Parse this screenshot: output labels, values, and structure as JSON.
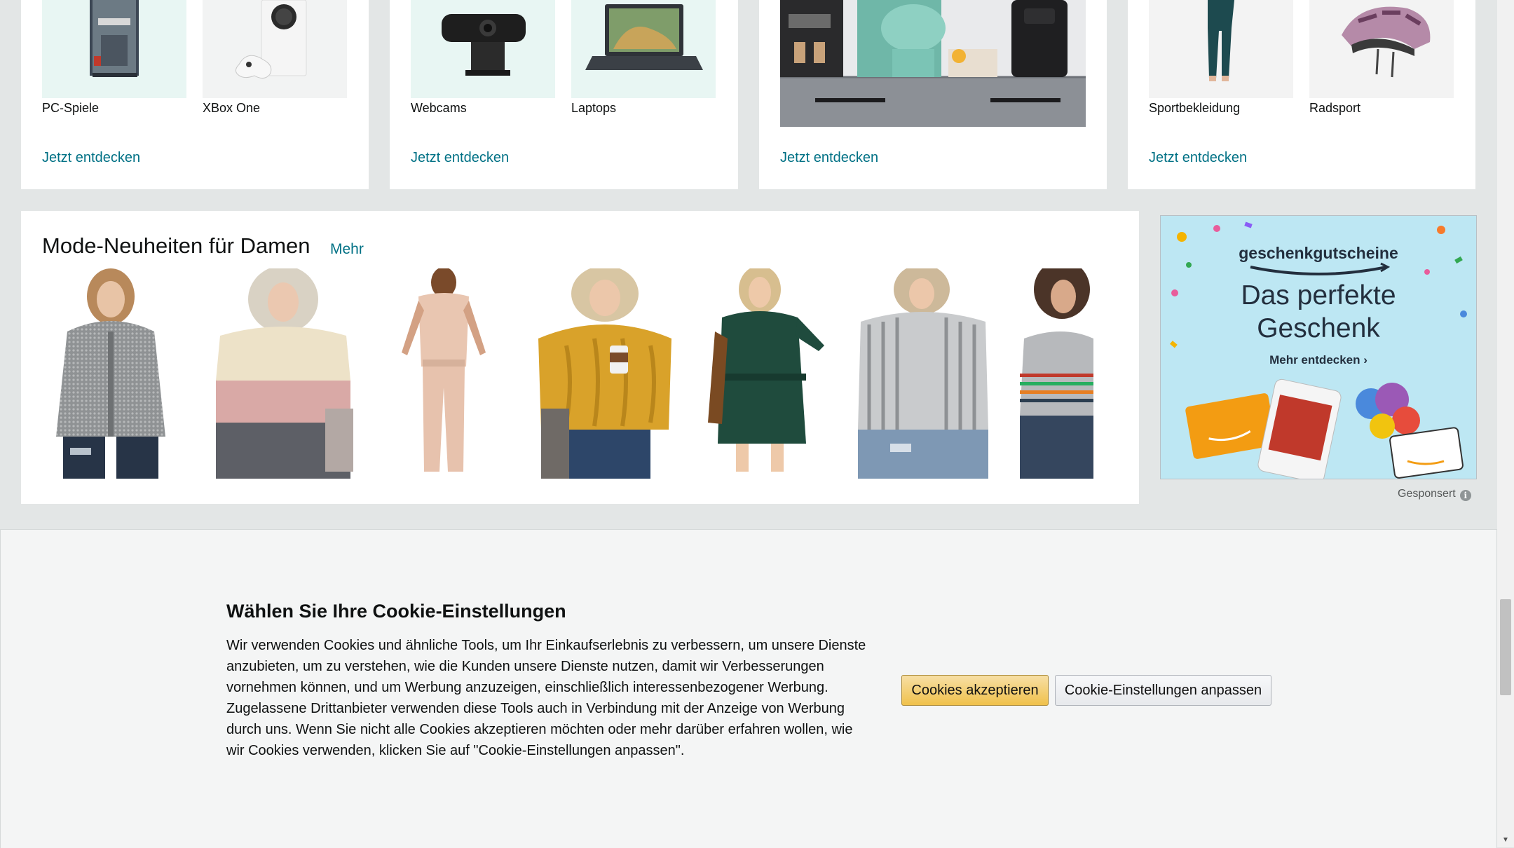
{
  "category_cards": [
    {
      "tiles": [
        {
          "label": "PC-Spiele",
          "image": "pc-game-box"
        },
        {
          "label": "XBox One",
          "image": "xbox-console"
        }
      ],
      "link": "Jetzt entdecken"
    },
    {
      "tiles": [
        {
          "label": "Webcams",
          "image": "webcam"
        },
        {
          "label": "Laptops",
          "image": "laptop"
        }
      ],
      "link": "Jetzt entdecken"
    },
    {
      "image": "kitchen-appliances",
      "link": "Jetzt entdecken"
    },
    {
      "tiles": [
        {
          "label": "Sportbekleidung",
          "image": "leggings"
        },
        {
          "label": "Radsport",
          "image": "bike-helmet"
        }
      ],
      "link": "Jetzt entdecken"
    }
  ],
  "fashion": {
    "title": "Mode-Neuheiten für Damen",
    "more_link": "Mehr",
    "items": [
      {
        "image": "grey-knit-jacket"
      },
      {
        "image": "pink-colorblock-sweater"
      },
      {
        "image": "beige-jumpsuit"
      },
      {
        "image": "mustard-cable-sweater"
      },
      {
        "image": "green-knit-dress"
      },
      {
        "image": "striped-shirt"
      },
      {
        "image": "striped-tank-top"
      }
    ]
  },
  "ad": {
    "brand": "geschenkgutscheine",
    "headline_line1": "Das perfekte",
    "headline_line2": "Geschenk",
    "cta": "Mehr entdecken ›",
    "sponsored": "Gesponsert"
  },
  "cookie_banner": {
    "title": "Wählen Sie Ihre Cookie-Einstellungen",
    "body": "Wir verwenden Cookies und ähnliche Tools, um Ihr Einkaufserlebnis zu verbessern, um unsere Dienste anzubieten, um zu verstehen, wie die Kunden unsere Dienste nutzen, damit wir Verbesserungen vornehmen können, und um Werbung anzuzeigen, einschließlich interessenbezogener Werbung. Zugelassene Drittanbieter verwenden diese Tools auch in Verbindung mit der Anzeige von Werbung durch uns. Wenn Sie nicht alle Cookies akzeptieren möchten oder mehr darüber erfahren wollen, wie wir Cookies verwenden, klicken Sie auf \"Cookie-Einstellungen anpassen\".",
    "accept_button": "Cookies akzeptieren",
    "customize_button": "Cookie-Einstellungen anpassen"
  },
  "colors": {
    "link": "#007185",
    "page_bg": "#e3e6e6",
    "accept_button": "#f0c14b"
  }
}
